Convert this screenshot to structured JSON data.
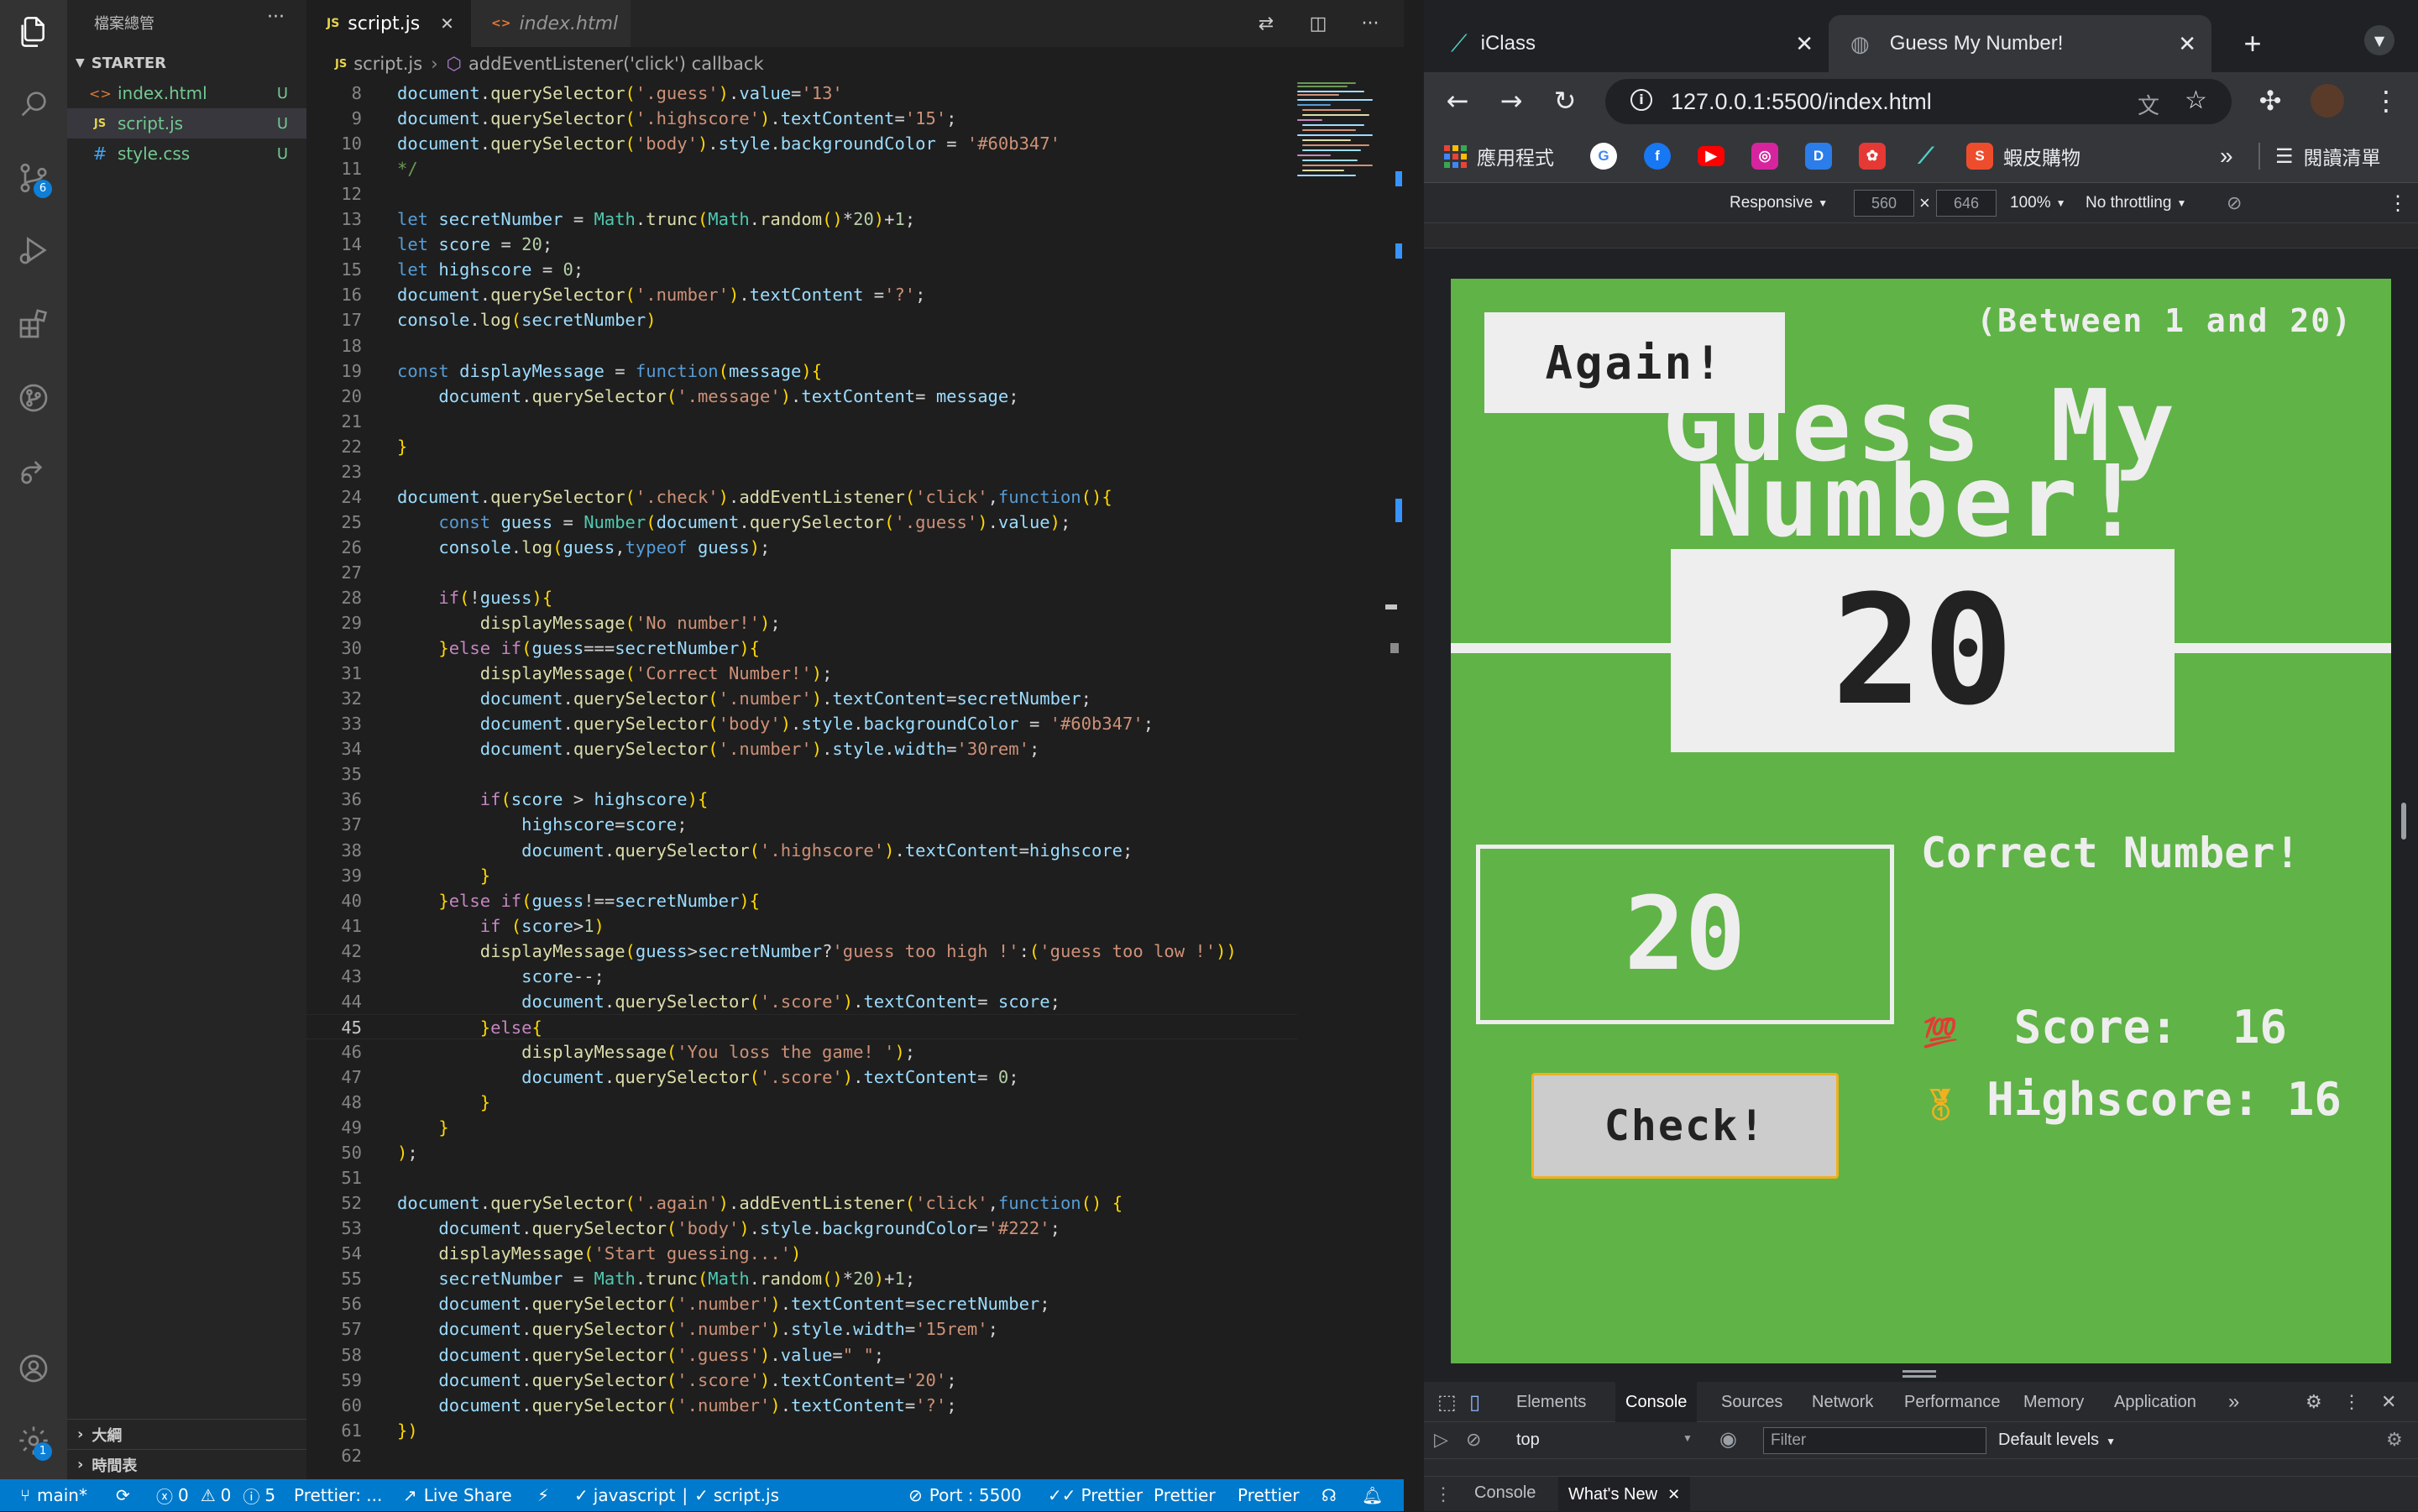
{
  "vscode": {
    "explorer": {
      "title": "檔案總管",
      "more": "···",
      "folder": "STARTER",
      "files": [
        {
          "name": "index.html",
          "icon": "<>",
          "status": "U"
        },
        {
          "name": "script.js",
          "icon": "JS",
          "status": "U"
        },
        {
          "name": "style.css",
          "icon": "#",
          "status": "U"
        }
      ],
      "outline": "大綱",
      "timeline": "時間表"
    },
    "activity_badges": {
      "source_control": "6",
      "accounts": "1"
    },
    "tabs": [
      {
        "label": "script.js",
        "icon": "JS"
      },
      {
        "label": "index.html",
        "icon": "<>"
      }
    ],
    "breadcrumb": {
      "file": "script.js",
      "symbol": "addEventListener('click') callback"
    },
    "code_lines": [
      {
        "n": "8",
        "t": "document.querySelector('.guess').value='13'"
      },
      {
        "n": "9",
        "t": "document.querySelector('.highscore').textContent='15';"
      },
      {
        "n": "10",
        "t": "document.querySelector('body').style.backgroundColor = '#60b347'"
      },
      {
        "n": "11",
        "t": "*/"
      },
      {
        "n": "12",
        "t": ""
      },
      {
        "n": "13",
        "t": "let secretNumber = Math.trunc(Math.random()*20)+1;"
      },
      {
        "n": "14",
        "t": "let score = 20;"
      },
      {
        "n": "15",
        "t": "let highscore = 0;"
      },
      {
        "n": "16",
        "t": "document.querySelector('.number').textContent ='?';"
      },
      {
        "n": "17",
        "t": "console.log(secretNumber)"
      },
      {
        "n": "18",
        "t": ""
      },
      {
        "n": "19",
        "t": "const displayMessage = function(message){"
      },
      {
        "n": "20",
        "t": "    document.querySelector('.message').textContent= message;"
      },
      {
        "n": "21",
        "t": ""
      },
      {
        "n": "22",
        "t": "}"
      },
      {
        "n": "23",
        "t": ""
      },
      {
        "n": "24",
        "t": "document.querySelector('.check').addEventListener('click',function(){"
      },
      {
        "n": "25",
        "t": "    const guess = Number(document.querySelector('.guess').value);"
      },
      {
        "n": "26",
        "t": "    console.log(guess,typeof guess);"
      },
      {
        "n": "27",
        "t": ""
      },
      {
        "n": "28",
        "t": "    if(!guess){"
      },
      {
        "n": "29",
        "t": "        displayMessage('No number!');"
      },
      {
        "n": "30",
        "t": "    }else if(guess===secretNumber){"
      },
      {
        "n": "31",
        "t": "        displayMessage('Correct Number!');"
      },
      {
        "n": "32",
        "t": "        document.querySelector('.number').textContent=secretNumber;"
      },
      {
        "n": "33",
        "t": "        document.querySelector('body').style.backgroundColor = '#60b347';"
      },
      {
        "n": "34",
        "t": "        document.querySelector('.number').style.width='30rem';"
      },
      {
        "n": "35",
        "t": ""
      },
      {
        "n": "36",
        "t": "        if(score > highscore){"
      },
      {
        "n": "37",
        "t": "            highscore=score;"
      },
      {
        "n": "38",
        "t": "            document.querySelector('.highscore').textContent=highscore;"
      },
      {
        "n": "39",
        "t": "        }"
      },
      {
        "n": "40",
        "t": "    }else if(guess!==secretNumber){"
      },
      {
        "n": "41",
        "t": "        if (score>1)"
      },
      {
        "n": "42",
        "t": "        displayMessage(guess>secretNumber?'guess too high !':('guess too low !'))"
      },
      {
        "n": "43",
        "t": "            score--;"
      },
      {
        "n": "44",
        "t": "            document.querySelector('.score').textContent= score;"
      },
      {
        "n": "45",
        "t": "        }else{"
      },
      {
        "n": "46",
        "t": "            displayMessage('You loss the game! ');"
      },
      {
        "n": "47",
        "t": "            document.querySelector('.score').textContent= 0;"
      },
      {
        "n": "48",
        "t": "        }"
      },
      {
        "n": "49",
        "t": "    }"
      },
      {
        "n": "50",
        "t": ");"
      },
      {
        "n": "51",
        "t": ""
      },
      {
        "n": "52",
        "t": "document.querySelector('.again').addEventListener('click',function() {"
      },
      {
        "n": "53",
        "t": "    document.querySelector('body').style.backgroundColor='#222';"
      },
      {
        "n": "54",
        "t": "    displayMessage('Start guessing...')"
      },
      {
        "n": "55",
        "t": "    secretNumber = Math.trunc(Math.random()*20)+1;"
      },
      {
        "n": "56",
        "t": "    document.querySelector('.number').textContent=secretNumber;"
      },
      {
        "n": "57",
        "t": "    document.querySelector('.number').style.width='15rem';"
      },
      {
        "n": "58",
        "t": "    document.querySelector('.guess').value=\" \";"
      },
      {
        "n": "59",
        "t": "    document.querySelector('.score').textContent='20';"
      },
      {
        "n": "60",
        "t": "    document.querySelector('.number').textContent='?';"
      },
      {
        "n": "61",
        "t": "})"
      },
      {
        "n": "62",
        "t": ""
      }
    ],
    "current_line": "45",
    "statusbar": {
      "branch": "main*",
      "errors": "0",
      "warnings": "0",
      "info": "5",
      "prettier_left": "Prettier: ...",
      "live_share": "Live Share",
      "language": "javascript",
      "file": "script.js",
      "port": "Port : 5500",
      "prettier1": "Prettier",
      "prettier2": "Prettier",
      "prettier3": "Prettier"
    }
  },
  "chrome": {
    "tabs": [
      {
        "title": "iClass",
        "active": false
      },
      {
        "title": "Guess My Number!",
        "active": true
      }
    ],
    "new_tab": "+",
    "url_host": "127.0.0.1",
    "url_path": ":5500/index.html",
    "bookmarks": {
      "apps": "應用程式",
      "shopee": "蝦皮購物",
      "more": "»",
      "reading_list": "閱讀清單"
    },
    "device_toolbar": {
      "mode": "Responsive",
      "width": "560",
      "height": "646",
      "zoom": "100%",
      "throttle": "No throttling"
    },
    "devtools": {
      "tabs": [
        "Elements",
        "Console",
        "Sources",
        "Network",
        "Performance",
        "Memory",
        "Application"
      ],
      "selected_tab": "Console",
      "context": "top",
      "filter_placeholder": "Filter",
      "levels": "Default levels",
      "drawer_tabs": [
        "Console",
        "What's New"
      ]
    }
  },
  "game": {
    "again": "Again!",
    "between": "(Between 1 and 20)",
    "title_line1": "Guess My",
    "title_line2": "Number!",
    "number": "20",
    "guess_value": "20",
    "check": "Check!",
    "message": "Correct Number!",
    "score_label": "Score:",
    "score": "16",
    "highscore_label": "Highscore:",
    "highscore": "16",
    "background": "#60b347"
  }
}
